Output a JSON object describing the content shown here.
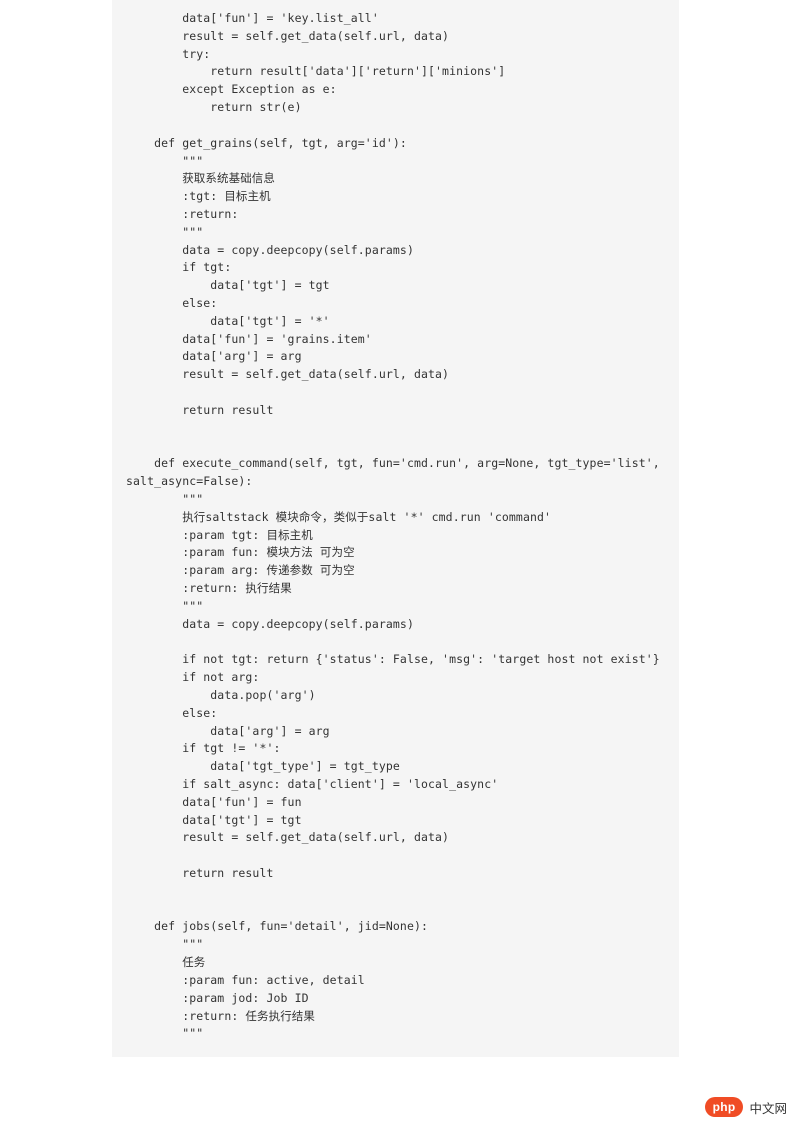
{
  "code": "        data['fun'] = 'key.list_all'\n        result = self.get_data(self.url, data)\n        try:\n            return result['data']['return']['minions']\n        except Exception as e:\n            return str(e)\n\n    def get_grains(self, tgt, arg='id'):\n        \"\"\"\n        获取系统基础信息\n        :tgt: 目标主机\n        :return:\n        \"\"\"\n        data = copy.deepcopy(self.params)\n        if tgt:\n            data['tgt'] = tgt\n        else:\n            data['tgt'] = '*'\n        data['fun'] = 'grains.item'\n        data['arg'] = arg\n        result = self.get_data(self.url, data)\n\n        return result\n\n\n    def execute_command(self, tgt, fun='cmd.run', arg=None, tgt_type='list',\nsalt_async=False):\n        \"\"\"\n        执行saltstack 模块命令，类似于salt '*' cmd.run 'command'\n        :param tgt: 目标主机\n        :param fun: 模块方法 可为空\n        :param arg: 传递参数 可为空\n        :return: 执行结果\n        \"\"\"\n        data = copy.deepcopy(self.params)\n\n        if not tgt: return {'status': False, 'msg': 'target host not exist'}\n        if not arg:\n            data.pop('arg')\n        else:\n            data['arg'] = arg\n        if tgt != '*':\n            data['tgt_type'] = tgt_type\n        if salt_async: data['client'] = 'local_async'\n        data['fun'] = fun\n        data['tgt'] = tgt\n        result = self.get_data(self.url, data)\n\n        return result\n\n\n    def jobs(self, fun='detail', jid=None):\n        \"\"\"\n        任务\n        :param fun: active, detail\n        :param jod: Job ID\n        :return: 任务执行结果\n        \"\"\"",
  "badge": {
    "pill": "php",
    "text": "中文网"
  }
}
